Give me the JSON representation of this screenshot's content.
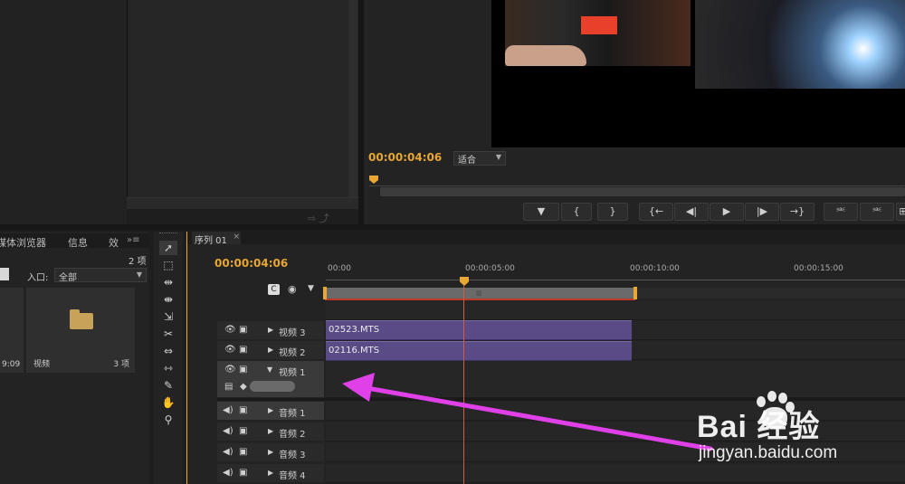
{
  "program_monitor": {
    "timecode": "00:00:04:06",
    "fit_label": "适合",
    "transport": [
      "▼",
      "{",
      "}",
      "{←",
      "◀|",
      "▶",
      "|▶",
      "→}",
      "⎃",
      "⎃",
      "⊞"
    ]
  },
  "project_panel": {
    "tabs": [
      "媒体浏览器",
      "信息",
      "效"
    ],
    "count": "2 项",
    "entry_label": "入口:",
    "entry_value": "全部",
    "items": [
      {
        "name": "",
        "meta": "9:09"
      },
      {
        "name": "视频",
        "meta": "3 项"
      }
    ]
  },
  "sequence": {
    "tab_label": "序列 01",
    "timecode": "00:00:04:06",
    "ruler_labels": [
      "00:00",
      "00:00:05:00",
      "00:00:10:00",
      "00:00:15:00"
    ],
    "video_tracks": [
      {
        "name": "视频 3",
        "clip": "02523.MTS"
      },
      {
        "name": "视频 2",
        "clip": "02116.MTS"
      },
      {
        "name": "视频 1",
        "clip": ""
      }
    ],
    "audio_tracks": [
      {
        "name": "音频 1"
      },
      {
        "name": "音频 2"
      },
      {
        "name": "音频 3"
      },
      {
        "name": "音频 4"
      }
    ]
  },
  "tools": [
    "selection-tool",
    "track-select-tool",
    "ripple-edit-tool",
    "rolling-edit-tool",
    "rate-stretch-tool",
    "razor-tool",
    "slip-tool",
    "slide-tool",
    "pen-tool",
    "hand-tool",
    "zoom-tool"
  ],
  "watermark": {
    "brand": "Bai 经验",
    "url": "jingyan.baidu.com"
  },
  "colors": {
    "timecode": "#e8a632",
    "clip": "#5a4a86",
    "playhead": "#d85a3a",
    "annotation_arrow": "#e040e8"
  }
}
